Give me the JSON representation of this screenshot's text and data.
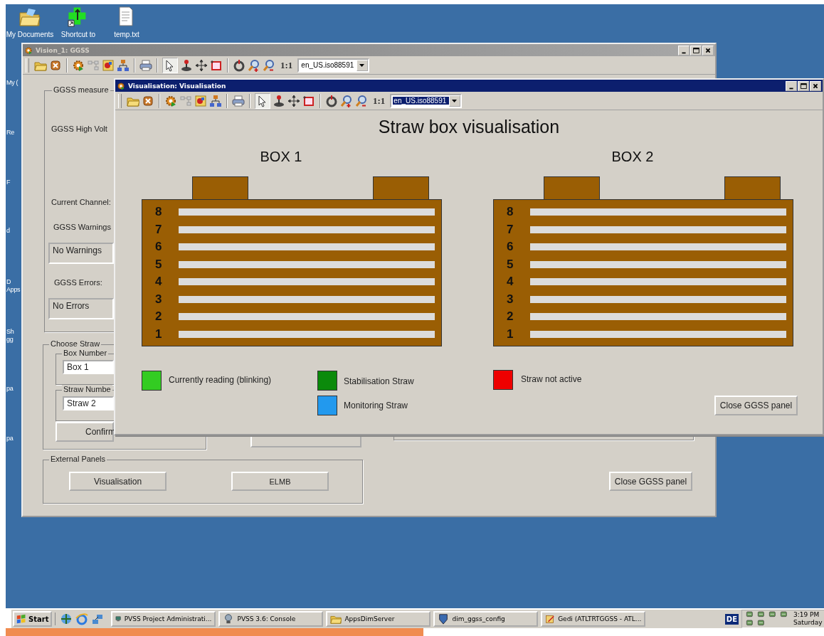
{
  "desktop": {
    "icons": [
      {
        "label": "My Documents",
        "kind": "folder"
      },
      {
        "label": "Shortcut to",
        "kind": "shortcut"
      },
      {
        "label": "temp.txt",
        "kind": "textfile"
      }
    ],
    "partial_labels": [
      "My (",
      "Re",
      "F",
      "d",
      "D",
      "Apps",
      "Sh",
      "gg",
      "pa",
      "pa"
    ]
  },
  "windows": [
    {
      "title": "Vision_1: GGSS",
      "active": false,
      "toolbar": {
        "zoom_label": "1:1",
        "locale": "en_US.iso88591",
        "locale_highlighted": false
      },
      "panel": {
        "measure_group": "GGSS measure",
        "labels": [
          "GGSS High Volt",
          "Current Channel:",
          "GGSS Warnings"
        ],
        "warnings": "No Warnings",
        "errors_label": "GGSS Errors:",
        "errors": "No Errors",
        "choose_straw": {
          "title": "Choose Straw",
          "box_label": "Box Number",
          "box_value": "Box 1",
          "straw_label": "Straw Numbe",
          "straw_value": "Straw 2",
          "confirm": "Confirm"
        },
        "external": {
          "title": "External Panels",
          "buttons": [
            "Visualisation",
            "ELMB"
          ]
        },
        "close_button": "Close GGSS panel"
      }
    },
    {
      "title": "Visualisation: Visualisation",
      "active": true,
      "toolbar": {
        "zoom_label": "1:1",
        "locale": "en_US.iso88591",
        "locale_highlighted": true
      },
      "panel": {
        "heading": "Straw box visualisation",
        "boxes": [
          {
            "label": "BOX 1",
            "straws": [
              "8",
              "7",
              "6",
              "5",
              "4",
              "3",
              "2",
              "1"
            ]
          },
          {
            "label": "BOX 2",
            "straws": [
              "8",
              "7",
              "6",
              "5",
              "4",
              "3",
              "2",
              "1"
            ]
          }
        ],
        "legend": [
          {
            "label": "Currently reading (blinking)",
            "color": "#33cc22"
          },
          {
            "label": "Stabilisation Straw",
            "color": "#0b8a0b"
          },
          {
            "label": "Monitoring Straw",
            "color": "#2299ee"
          },
          {
            "label": "Straw not active",
            "color": "#ee0000"
          }
        ],
        "close_button": "Close GGSS panel"
      }
    }
  ],
  "taskbar": {
    "start": "Start",
    "tasks": [
      {
        "label": "PVSS Project Administrati...",
        "kind": "monitor"
      },
      {
        "label": "PVSS 3.6: Console",
        "kind": "bulb"
      },
      {
        "label": "AppsDimServer",
        "kind": "folder"
      },
      {
        "label": "dim_ggss_config",
        "kind": "shield"
      },
      {
        "label": "Gedi (ATLTRTGGSS - ATL...",
        "kind": "editor"
      }
    ],
    "language": "DE",
    "clock": "3:19 PM",
    "day": "Saturday"
  }
}
